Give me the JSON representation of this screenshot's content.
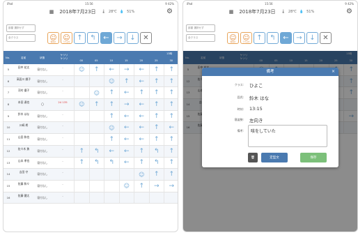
{
  "status": {
    "carrier": "iPad",
    "time": "15:56",
    "battery": "9 42%"
  },
  "toolbar": {
    "date": "2018年7月23日",
    "temp": "28",
    "temp_unit": "℃",
    "humidity": "51",
    "humidity_unit": "%"
  },
  "filters": {
    "room": "部屋 選択せず",
    "class": "全クラス"
  },
  "buttons": [
    {
      "icon": "face-icon",
      "glyph": "☺",
      "caption": "仰向け",
      "style": "orange"
    },
    {
      "icon": "face-icon",
      "glyph": "☺",
      "caption": "うつぶせ",
      "style": "orange"
    },
    {
      "icon": "up-arrow-icon",
      "glyph": "↑",
      "caption": "",
      "style": ""
    },
    {
      "icon": "turn-icon",
      "glyph": "↰",
      "caption": "",
      "style": ""
    },
    {
      "icon": "left-arrow-icon",
      "glyph": "←",
      "caption": "",
      "style": "sel"
    },
    {
      "icon": "right-arrow-icon",
      "glyph": "→",
      "caption": "",
      "style": ""
    },
    {
      "icon": "down-arrow-icon",
      "glyph": "↓",
      "caption": "",
      "style": ""
    },
    {
      "icon": "close-icon",
      "glyph": "✕",
      "caption": "",
      "style": "x"
    }
  ],
  "table_header": {
    "no": "No.",
    "name": "名前",
    "state": "状態",
    "temp": "ケツリ\nケツリ",
    "hour": "13時",
    "minutes": [
      "00",
      "05",
      "10",
      "15",
      "20",
      "25",
      "30"
    ]
  },
  "rows_left": [
    {
      "no": "5",
      "name": "田中 花太",
      "state": "寝付なし",
      "temp": "-",
      "cells": [
        "☺",
        "↑",
        "←",
        "→",
        "←",
        "↑",
        "↑"
      ]
    },
    {
      "no": "6",
      "name": "高田川 鋼子",
      "state": "寝付なし",
      "temp": "-",
      "cells": [
        "",
        "",
        "☺",
        "↑",
        "←",
        "↑",
        "↑"
      ]
    },
    {
      "no": "7",
      "name": "河村 優子",
      "state": "寝付なし",
      "temp": "-",
      "cells": [
        "",
        "☺",
        "↑",
        "←",
        "↑",
        "↑",
        "↑"
      ]
    },
    {
      "no": "8",
      "name": "本田 達也",
      "state": "〇",
      "temp": "24 135",
      "cells": [
        "☺",
        "↑",
        "↑",
        "→",
        "←",
        "↑",
        "↑"
      ]
    },
    {
      "no": "9",
      "name": "鈴木 はな",
      "state": "寝付なし",
      "temp": "-",
      "cells": [
        "",
        "",
        "↑",
        "←",
        "←",
        "↑",
        "↑"
      ]
    },
    {
      "no": "10",
      "name": "川崎 柊",
      "state": "寝付なし",
      "temp": "-",
      "cells": [
        "",
        "",
        "☺",
        "←",
        "←",
        "↑",
        "←"
      ]
    },
    {
      "no": "11",
      "name": "山田 和也",
      "state": "寝付なし",
      "temp": "-",
      "cells": [
        "",
        "",
        "↑",
        "←",
        "←",
        "↑",
        "↑"
      ]
    },
    {
      "no": "12",
      "name": "佐々木 勇",
      "state": "寝付なし",
      "temp": "-",
      "cells": [
        "↑",
        "↰",
        "←",
        "←",
        "↑",
        "↰",
        "↑"
      ]
    },
    {
      "no": "13",
      "name": "山本 孝也",
      "state": "寝付なし",
      "temp": "-",
      "cells": [
        "↑",
        "↰",
        "↰",
        "←",
        "↑",
        "↰",
        "↑"
      ]
    },
    {
      "no": "14",
      "name": "吉田 守",
      "state": "寝付なし",
      "temp": "-",
      "cells": [
        "",
        "",
        "",
        "",
        "☺",
        "↑",
        "↑"
      ]
    },
    {
      "no": "15",
      "name": "佐藤 和々",
      "state": "寝付なし",
      "temp": "-",
      "cells": [
        "",
        "",
        "",
        "☺",
        "↑",
        "→",
        "→"
      ]
    },
    {
      "no": "16",
      "name": "佐藤 健太",
      "state": "寝付なし",
      "temp": "-",
      "cells": [
        "",
        "",
        "",
        "",
        "",
        "",
        ""
      ]
    }
  ],
  "rows_right": [
    {
      "no": "5",
      "name": "田中 花太",
      "state": "寝付なし",
      "temp": "-",
      "cells": [
        "☺",
        "↑",
        "←",
        "→",
        "←",
        "↑",
        "↑"
      ]
    },
    {
      "no": "12",
      "name": "佐々木 勇",
      "state": "寝付なし",
      "temp": "-",
      "cells": [
        "↑",
        "↰",
        "←",
        "←",
        "↑",
        "↰",
        "↑"
      ]
    },
    {
      "no": "13",
      "name": "山本 孝也",
      "state": "寝付なし",
      "temp": "-",
      "cells": [
        "↑",
        "↰",
        "↰",
        "←",
        "↑",
        "↰",
        "↑"
      ]
    },
    {
      "no": "14",
      "name": "吉田 守",
      "state": "寝付なし",
      "temp": "-",
      "cells": [
        "",
        "",
        "",
        "",
        "",
        "",
        ""
      ]
    },
    {
      "no": "15",
      "name": "佐藤 和々",
      "state": "寝付なし",
      "temp": "-",
      "cells": [
        "",
        "",
        "",
        "☺",
        "↑",
        "→",
        "→"
      ]
    },
    {
      "no": "16",
      "name": "佐藤 健太",
      "state": "寝付なし",
      "temp": "-",
      "cells": [
        "",
        "",
        "",
        "",
        "",
        "",
        ""
      ]
    }
  ],
  "modal": {
    "title": "備考",
    "fields": [
      {
        "label": "クラス:",
        "value": "ひよこ"
      },
      {
        "label": "園児:",
        "value": "鈴木 はな"
      },
      {
        "label": "時刻:",
        "value": "13:15"
      },
      {
        "label": "寝姿勢:",
        "value": "左向き"
      }
    ],
    "memo_label": "備考:",
    "memo_value": "咳をしていた",
    "buttons": {
      "delete": "🗑",
      "template": "定型文",
      "save": "保存"
    }
  }
}
